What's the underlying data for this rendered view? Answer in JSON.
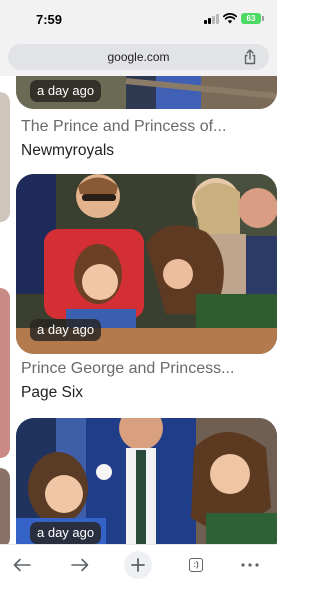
{
  "status_bar": {
    "time": "7:59",
    "battery": "63"
  },
  "browser": {
    "url": "google.com"
  },
  "cards": [
    {
      "time_label": "a day ago",
      "title": "The Prince and Princess of...",
      "source": "Newmyroyals"
    },
    {
      "time_label": "a day ago",
      "title": "Prince George and Princess...",
      "source": "Page Six"
    },
    {
      "time_label": "a day ago"
    }
  ],
  "toolbar": {
    "tab_count": ":)"
  },
  "icons": [
    "signal-icon",
    "wifi-icon",
    "battery-icon",
    "share-icon",
    "back-arrow-icon",
    "forward-arrow-icon",
    "new-tab-plus-icon",
    "tabs-icon",
    "more-dots-icon"
  ]
}
